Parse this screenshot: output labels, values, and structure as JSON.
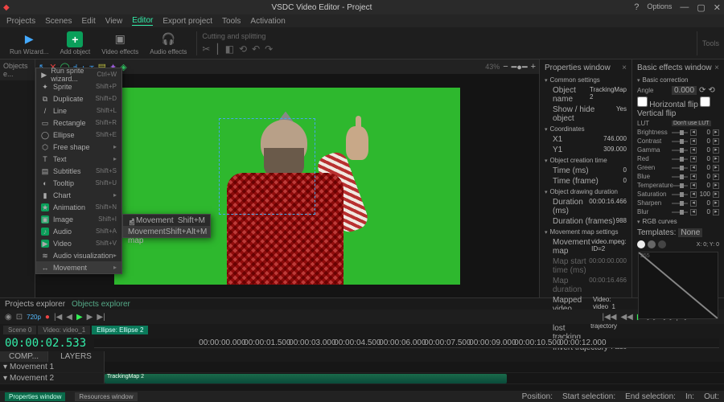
{
  "titlebar": {
    "title": "VSDC Video Editor - Project",
    "options": "Options"
  },
  "menubar": {
    "items": [
      "Projects",
      "Scenes",
      "Edit",
      "View",
      "Editor",
      "Export project",
      "Tools",
      "Activation"
    ],
    "active_index": 4
  },
  "maintoolbar": {
    "run_wizard": "Run Wizard...",
    "add_object": "Add object",
    "video_effects": "Video effects",
    "audio_effects": "Audio effects",
    "cutting": "Cutting and splitting",
    "tools": "Tools"
  },
  "objects_explorer": {
    "title": "Objects e..."
  },
  "dropdown": {
    "items": [
      {
        "icon": "▶",
        "label": "Run sprite wizard...",
        "shortcut": "Ctrl+W"
      },
      {
        "icon": "✦",
        "label": "Sprite",
        "shortcut": "Shift+P"
      },
      {
        "icon": "⧉",
        "label": "Duplicate",
        "shortcut": "Shift+D"
      },
      {
        "icon": "/",
        "label": "Line",
        "shortcut": "Shift+L"
      },
      {
        "icon": "▭",
        "label": "Rectangle",
        "shortcut": "Shift+R"
      },
      {
        "icon": "◯",
        "label": "Ellipse",
        "shortcut": "Shift+E"
      },
      {
        "icon": "⬡",
        "label": "Free shape",
        "submenu": true
      },
      {
        "icon": "T",
        "label": "Text",
        "submenu": true
      },
      {
        "icon": "▤",
        "label": "Subtitles",
        "shortcut": "Shift+S"
      },
      {
        "icon": "◐",
        "label": "Tooltip",
        "shortcut": "Shift+U"
      },
      {
        "icon": "▮",
        "label": "Chart",
        "submenu": true
      },
      {
        "icon": "★",
        "label": "Animation",
        "shortcut": "Shift+N"
      },
      {
        "icon": "▣",
        "label": "Image",
        "shortcut": "Shift+I"
      },
      {
        "icon": "♪",
        "label": "Audio",
        "shortcut": "Shift+A"
      },
      {
        "icon": "▶",
        "label": "Video",
        "shortcut": "Shift+V"
      },
      {
        "icon": "≋",
        "label": "Audio visualization",
        "submenu": true
      },
      {
        "icon": "↔",
        "label": "Movement",
        "submenu": true
      }
    ],
    "highlighted_index": 16
  },
  "submenu": {
    "items": [
      {
        "icon": "↗",
        "label": "Movement",
        "shortcut": "Shift+M"
      },
      {
        "icon": "⊞",
        "label": "Movement map",
        "shortcut": "Shift+Alt+M"
      }
    ],
    "highlighted_index": 1
  },
  "properties": {
    "title": "Properties window",
    "common": "Common settings",
    "object_name": {
      "k": "Object name",
      "v": "TrackingMap 2"
    },
    "show_hide": {
      "k": "Show / hide object",
      "v": "Yes"
    },
    "coordinates": "Coordinates",
    "x1": {
      "k": "X1",
      "v": "746.000"
    },
    "y1": {
      "k": "Y1",
      "v": "309.000"
    },
    "creation": "Object creation time",
    "time_ms": {
      "k": "Time (ms)",
      "v": "0"
    },
    "time_frame": {
      "k": "Time (frame)",
      "v": "0"
    },
    "drawing": "Object drawing duration",
    "dur_ms": {
      "k": "Duration (ms)",
      "v": "00:00:16.466"
    },
    "dur_frames": {
      "k": "Duration (frames)",
      "v": "988"
    },
    "movemap": "Movement map settings",
    "move_map": {
      "k": "Movement map",
      "v": "video.mpeg: ID=2"
    },
    "map_start": {
      "k": "Map start time (ms)",
      "v": "00:00:00.000"
    },
    "map_dur": {
      "k": "Map duration",
      "v": "00:00:16.466"
    },
    "mapped": {
      "k": "Mapped video",
      "v": "Video: video_1"
    },
    "process": {
      "k": "Process lost tracking",
      "v": "Approximate trajectory"
    },
    "invert": {
      "k": "Invert trajectory",
      "v": "False"
    }
  },
  "effects": {
    "title": "Basic effects window",
    "basic": "Basic correction",
    "angle": "Angle",
    "hflip": "Horizontal flip",
    "vflip": "Vertical flip",
    "lut": {
      "k": "LUT",
      "v": "Don't use LUT"
    },
    "sliders": [
      {
        "k": "Brightness",
        "v": "0"
      },
      {
        "k": "Contrast",
        "v": "0"
      },
      {
        "k": "Gamma",
        "v": "0"
      },
      {
        "k": "Red",
        "v": "0"
      },
      {
        "k": "Green",
        "v": "0"
      },
      {
        "k": "Blue",
        "v": "0"
      },
      {
        "k": "Temperature",
        "v": "0"
      },
      {
        "k": "Saturation",
        "v": "100"
      },
      {
        "k": "Sharpen",
        "v": "0"
      },
      {
        "k": "Blur",
        "v": "0"
      }
    ],
    "rgb": "RGB curves",
    "templates": "Templates:",
    "tpl_val": "None",
    "xy": "X: 0; Y: 0"
  },
  "transport": {
    "res": "720p",
    "fps": "43%",
    "explorer_tabs": [
      "Projects explorer",
      "Objects explorer"
    ]
  },
  "timeline": {
    "tabs": [
      "Scene 0",
      "Video: video_1",
      "Ellipse: Ellipse 2"
    ],
    "active_tab": 2,
    "timecode": "00:00:02.533",
    "ruler": [
      "00:00:00.000",
      "00:00:01.500",
      "00:00:03.000",
      "00:00:04.500",
      "00:00:06.000",
      "00:00:07.500",
      "00:00:09.000",
      "00:00:10.500",
      "00:00:12.000"
    ],
    "comp": "COMP...",
    "layers": "LAYERS",
    "tracks": [
      {
        "name": "Movement 1",
        "clip": ""
      },
      {
        "name": "Movement 2",
        "clip": "TrackingMap 2"
      }
    ]
  },
  "statusbar": {
    "tabs": [
      "Properties window",
      "Resources window"
    ],
    "pos": "Position:",
    "start": "Start selection:",
    "end": "End selection:",
    "in": "In:",
    "out": "Out:"
  }
}
